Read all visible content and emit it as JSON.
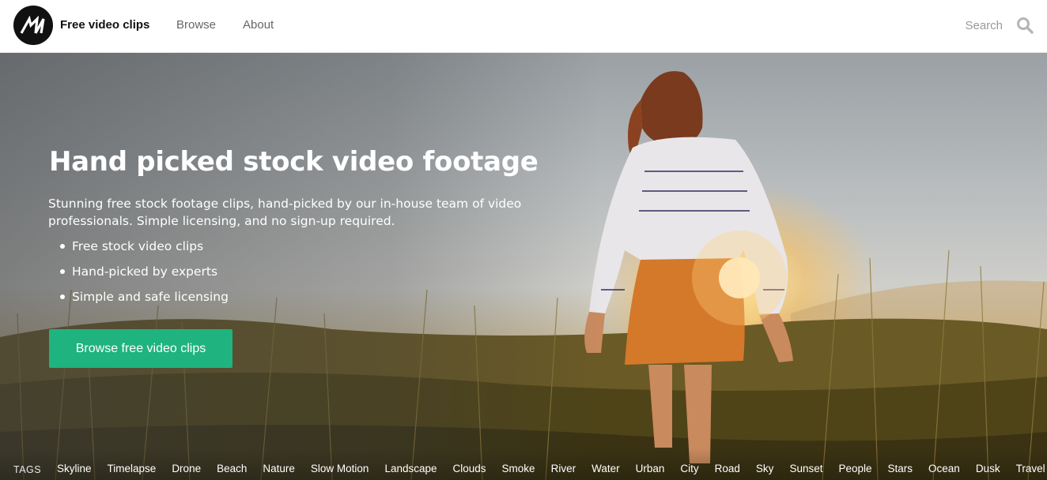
{
  "header": {
    "logo_icon": "mixkit-logo-icon",
    "brand": "Free video clips",
    "nav": [
      {
        "label": "Browse"
      },
      {
        "label": "About"
      }
    ],
    "search": {
      "placeholder": "Search",
      "icon": "search-icon"
    }
  },
  "hero": {
    "title": "Hand picked stock video footage",
    "subtitle": "Stunning free stock footage clips, hand-picked by our in-house team of video professionals. Simple licensing, and no sign-up required.",
    "features": [
      "Free stock video clips",
      "Hand-picked by experts",
      "Simple and safe licensing"
    ],
    "cta_label": "Browse free video clips",
    "cta_color": "#1fb37f"
  },
  "tags": {
    "label": "TAGS",
    "items": [
      "Skyline",
      "Timelapse",
      "Drone",
      "Beach",
      "Nature",
      "Slow Motion",
      "Landscape",
      "Clouds",
      "Smoke",
      "River",
      "Water",
      "Urban",
      "City",
      "Road",
      "Sky",
      "Sunset",
      "People",
      "Stars",
      "Ocean",
      "Dusk",
      "Travel"
    ]
  }
}
